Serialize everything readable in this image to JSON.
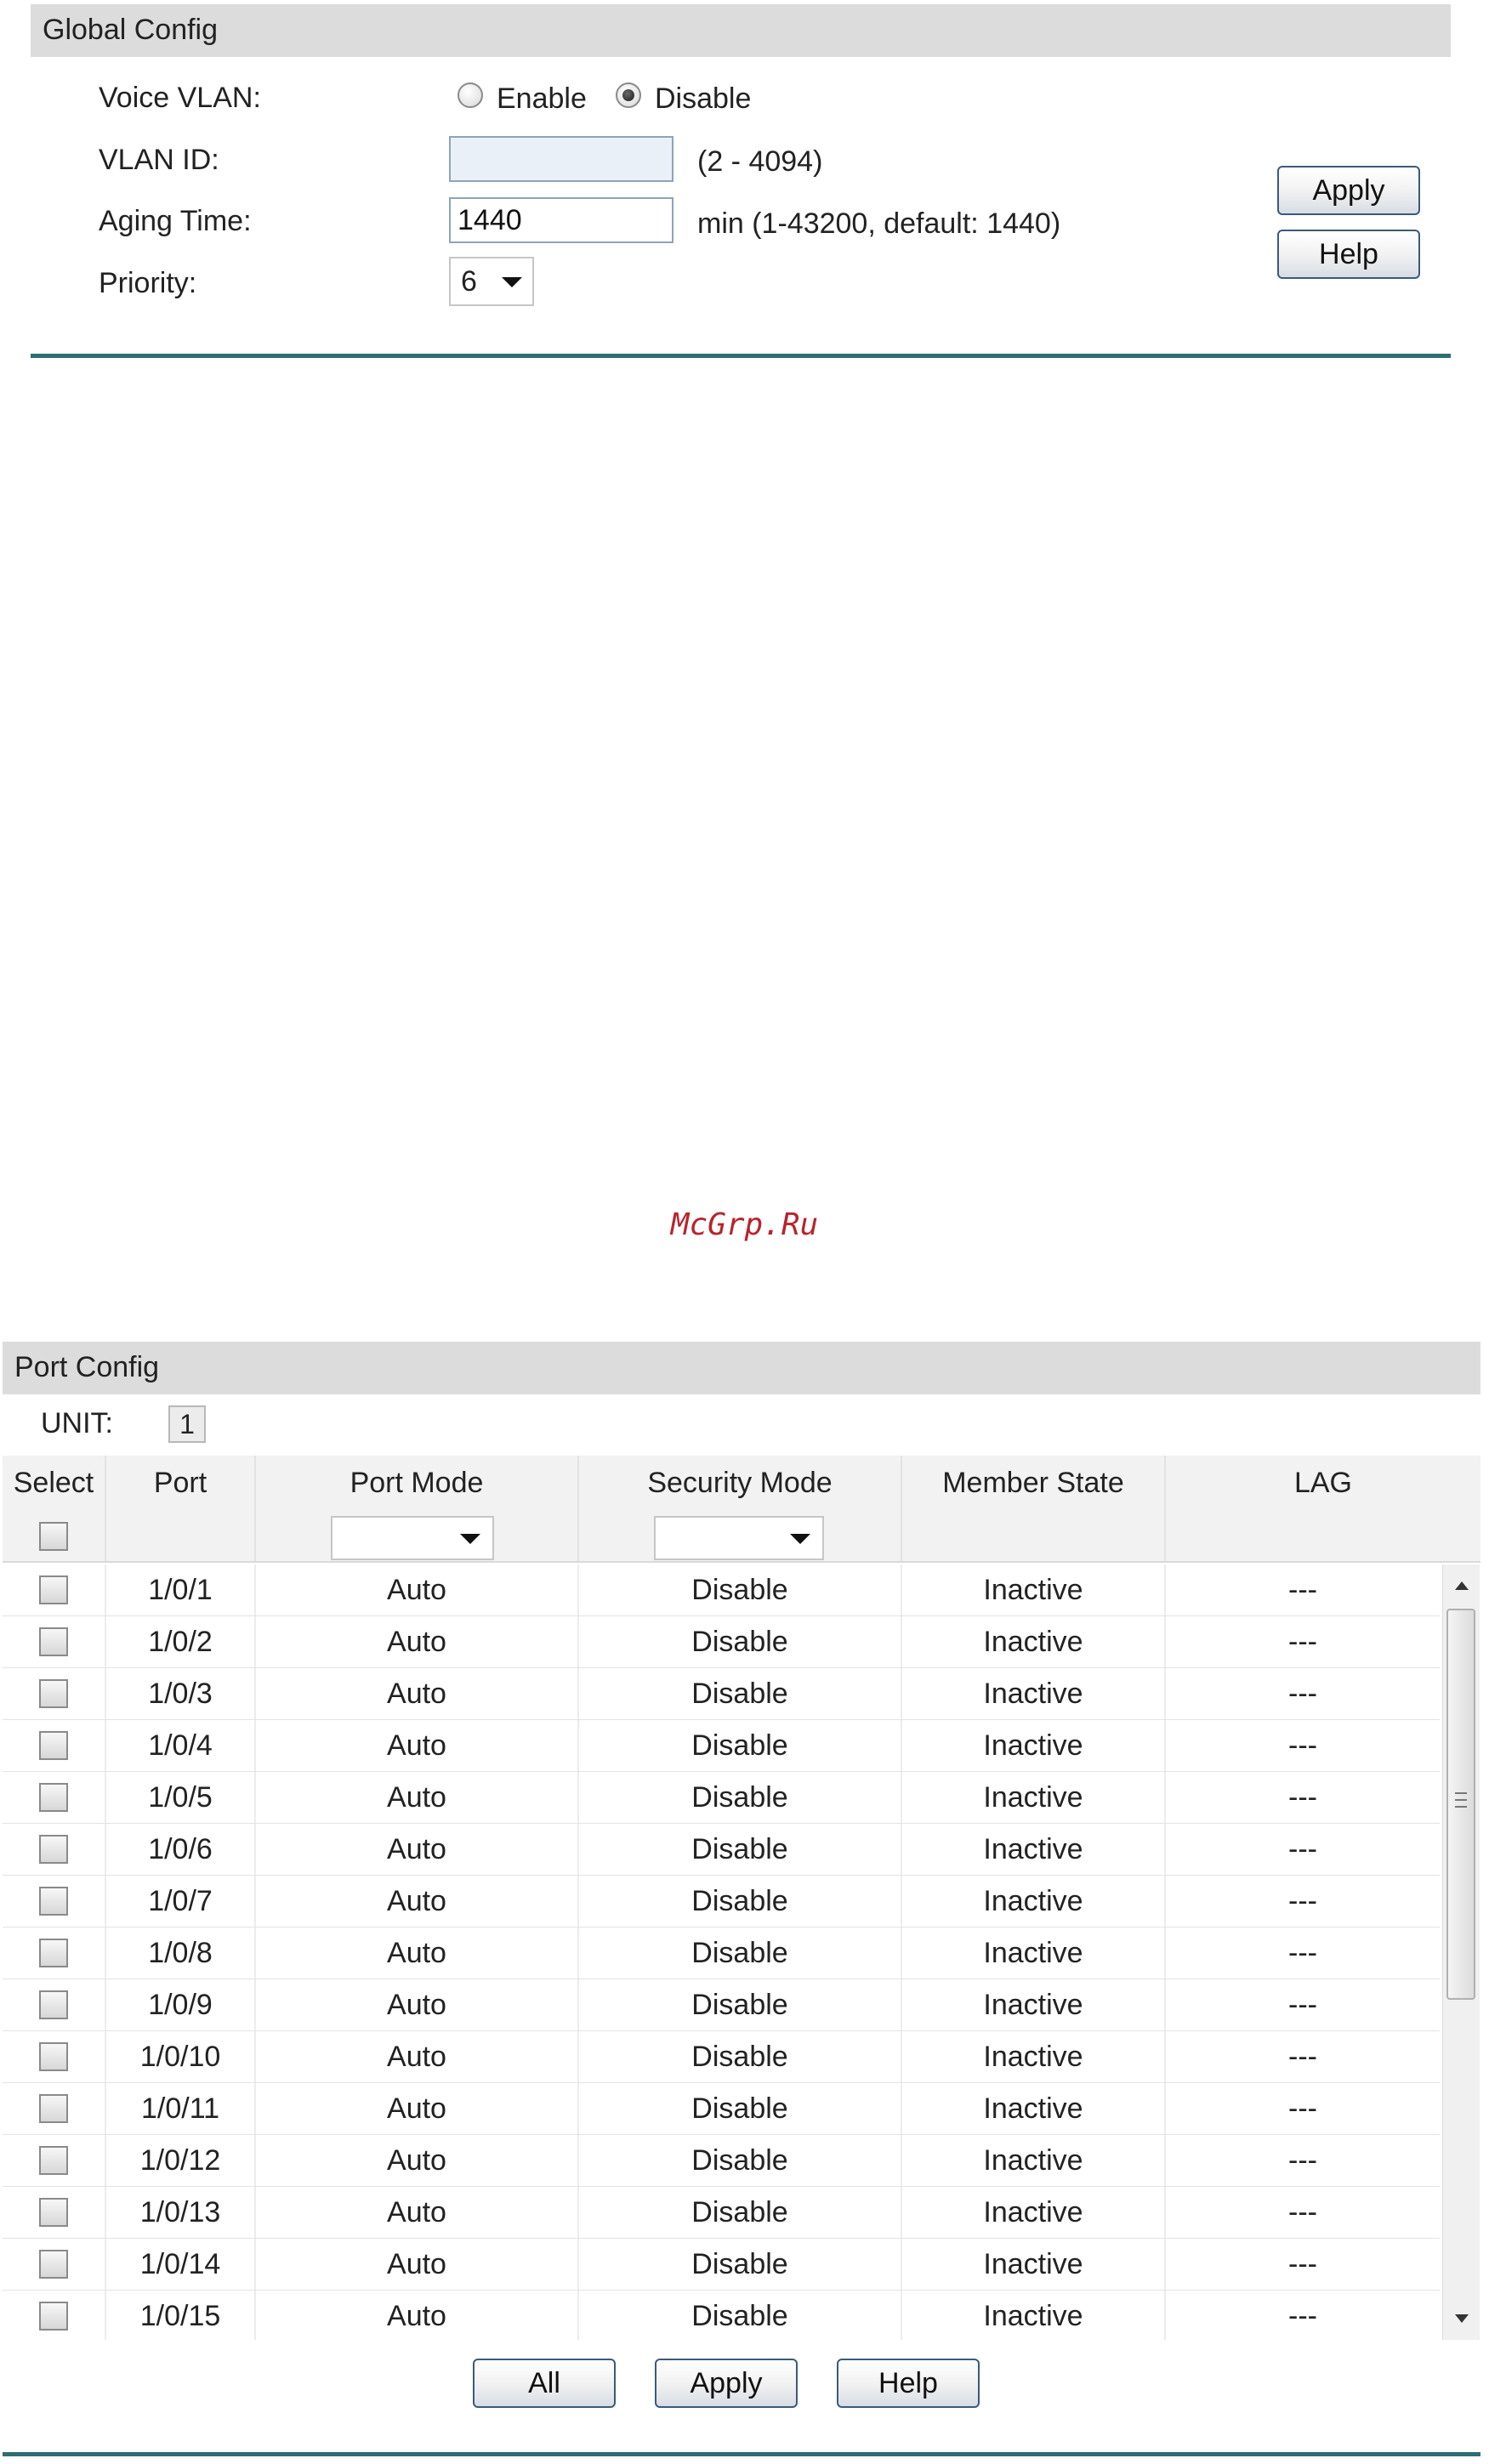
{
  "global_config": {
    "title": "Global Config",
    "voice_vlan": {
      "label": "Voice VLAN:",
      "options": [
        "Enable",
        "Disable"
      ],
      "selected": "Disable"
    },
    "vlan_id": {
      "label": "VLAN ID:",
      "value": "",
      "hint": "(2 - 4094)"
    },
    "aging_time": {
      "label": "Aging Time:",
      "value": "1440",
      "hint": "min (1-43200, default: 1440)"
    },
    "priority": {
      "label": "Priority:",
      "value": "6"
    },
    "apply_label": "Apply",
    "help_label": "Help",
    "colors": {
      "header_bg": "#dcdcdc",
      "rule": "#2d6e73",
      "button_border": "#3b5a7c"
    }
  },
  "watermark": "McGrp.Ru",
  "port_config": {
    "title": "Port Config",
    "unit_label": "UNIT:",
    "unit_value": "1",
    "columns": [
      "Select",
      "Port",
      "Port Mode",
      "Security Mode",
      "Member State",
      "LAG"
    ],
    "filters": {
      "port_mode": "",
      "security_mode": ""
    },
    "rows": [
      {
        "port": "1/0/1",
        "mode": "Auto",
        "security": "Disable",
        "state": "Inactive",
        "lag": "---"
      },
      {
        "port": "1/0/2",
        "mode": "Auto",
        "security": "Disable",
        "state": "Inactive",
        "lag": "---"
      },
      {
        "port": "1/0/3",
        "mode": "Auto",
        "security": "Disable",
        "state": "Inactive",
        "lag": "---"
      },
      {
        "port": "1/0/4",
        "mode": "Auto",
        "security": "Disable",
        "state": "Inactive",
        "lag": "---"
      },
      {
        "port": "1/0/5",
        "mode": "Auto",
        "security": "Disable",
        "state": "Inactive",
        "lag": "---"
      },
      {
        "port": "1/0/6",
        "mode": "Auto",
        "security": "Disable",
        "state": "Inactive",
        "lag": "---"
      },
      {
        "port": "1/0/7",
        "mode": "Auto",
        "security": "Disable",
        "state": "Inactive",
        "lag": "---"
      },
      {
        "port": "1/0/8",
        "mode": "Auto",
        "security": "Disable",
        "state": "Inactive",
        "lag": "---"
      },
      {
        "port": "1/0/9",
        "mode": "Auto",
        "security": "Disable",
        "state": "Inactive",
        "lag": "---"
      },
      {
        "port": "1/0/10",
        "mode": "Auto",
        "security": "Disable",
        "state": "Inactive",
        "lag": "---"
      },
      {
        "port": "1/0/11",
        "mode": "Auto",
        "security": "Disable",
        "state": "Inactive",
        "lag": "---"
      },
      {
        "port": "1/0/12",
        "mode": "Auto",
        "security": "Disable",
        "state": "Inactive",
        "lag": "---"
      },
      {
        "port": "1/0/13",
        "mode": "Auto",
        "security": "Disable",
        "state": "Inactive",
        "lag": "---"
      },
      {
        "port": "1/0/14",
        "mode": "Auto",
        "security": "Disable",
        "state": "Inactive",
        "lag": "---"
      },
      {
        "port": "1/0/15",
        "mode": "Auto",
        "security": "Disable",
        "state": "Inactive",
        "lag": "---"
      }
    ],
    "buttons": {
      "all_label": "All",
      "apply_label": "Apply",
      "help_label": "Help"
    }
  }
}
